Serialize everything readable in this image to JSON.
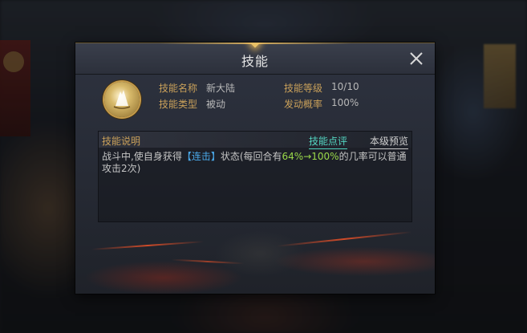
{
  "dialog": {
    "title": "技能",
    "close_icon": "close-icon"
  },
  "skill": {
    "icon": "skill-emblem-icon",
    "name_label": "技能名称",
    "name_value": "新大陆",
    "type_label": "技能类型",
    "type_value": "被动",
    "level_label": "技能等级",
    "level_value": "10/10",
    "rate_label": "发动概率",
    "rate_value": "100%"
  },
  "description": {
    "header": "技能说明",
    "comment_link": "技能点评",
    "preview_link": "本级预览",
    "text_part1": "战斗中,使自身获得",
    "keyword": "【连击】",
    "text_part2": "状态(每回合有",
    "rate_from": "64%",
    "arrow": "→",
    "rate_to": "100%",
    "text_part3": "的几率可以普通攻击2次)"
  },
  "colors": {
    "label_gold": "#c9a05a",
    "keyword_blue": "#4aa8e8",
    "highlight_green": "#9ad84a",
    "link_teal": "#53d6c2"
  }
}
